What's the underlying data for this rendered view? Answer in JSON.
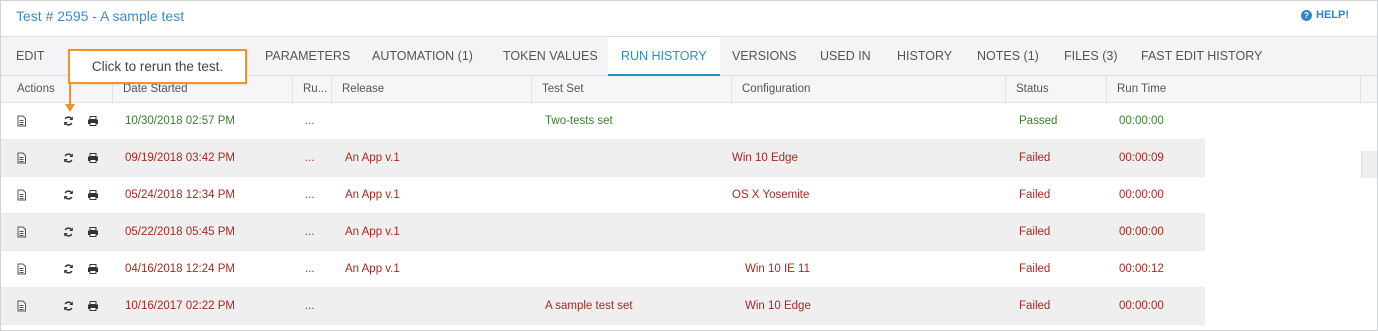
{
  "header": {
    "title": "Test # 2595 - A sample test",
    "help_label": "HELP!",
    "help_icon": "question-circle-icon"
  },
  "tabs": [
    {
      "label": "EDIT"
    },
    {
      "label": "PARAMETERS"
    },
    {
      "label": "AUTOMATION (1)"
    },
    {
      "label": "TOKEN VALUES"
    },
    {
      "label": "RUN HISTORY",
      "active": true
    },
    {
      "label": "VERSIONS"
    },
    {
      "label": "USED IN"
    },
    {
      "label": "HISTORY"
    },
    {
      "label": "NOTES (1)"
    },
    {
      "label": "FILES (3)"
    },
    {
      "label": "FAST EDIT HISTORY"
    }
  ],
  "callout": {
    "text": "Click to rerun the test."
  },
  "columns": {
    "actions": "Actions",
    "date_started": "Date Started",
    "run_by": "Ru...",
    "release": "Release",
    "test_set": "Test Set",
    "configuration": "Configuration",
    "status": "Status",
    "run_time": "Run Time"
  },
  "colors": {
    "accent": "#2d8fc1",
    "passed": "#3d7d2d",
    "failed": "#a62a22",
    "callout_border": "#f1922a"
  },
  "runs": [
    {
      "date": "10/30/2018 02:57 PM",
      "run_by": "...",
      "release": "",
      "test_set": "Two-tests set",
      "configuration": "",
      "status": "Passed",
      "run_time": "00:00:00"
    },
    {
      "date": "09/19/2018 03:42 PM",
      "run_by": "...",
      "release": "An App v.1",
      "test_set": "",
      "configuration": "Win 10 Edge",
      "status": "Failed",
      "run_time": "00:00:09"
    },
    {
      "date": "05/24/2018 12:34 PM",
      "run_by": "...",
      "release": "An App v.1",
      "test_set": "",
      "configuration": "OS X Yosemite",
      "status": "Failed",
      "run_time": "00:00:00"
    },
    {
      "date": "05/22/2018 05:45 PM",
      "run_by": "...",
      "release": "An App v.1",
      "test_set": "",
      "configuration": "",
      "status": "Failed",
      "run_time": "00:00:00"
    },
    {
      "date": "04/16/2018 12:24 PM",
      "run_by": "...",
      "release": "An App v.1",
      "test_set": "",
      "configuration": "Win 10 IE 11",
      "status": "Failed",
      "run_time": "00:00:12"
    },
    {
      "date": "10/16/2017 02:22 PM",
      "run_by": "...",
      "release": "",
      "test_set": "A sample test set",
      "configuration": "Win 10 Edge",
      "status": "Failed",
      "run_time": "00:00:00"
    }
  ]
}
